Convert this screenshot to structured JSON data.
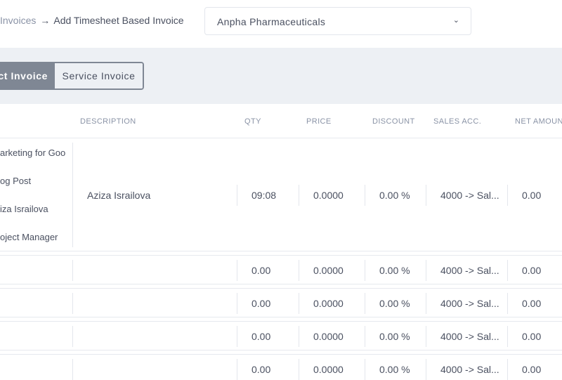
{
  "header": {
    "breadcrumb_link": "Invoices",
    "breadcrumb_arrow": "→",
    "breadcrumb_current": "Add Timesheet Based Invoice",
    "customer_value": "Anpha Pharmaceuticals"
  },
  "toggle": {
    "product_label": "ct Invoice",
    "service_label": "Service Invoice"
  },
  "table": {
    "columns": {
      "description": "DESCRIPTION",
      "qty": "QTY",
      "price": "PRICE",
      "discount": "DISCOUNT",
      "sales_acc": "SALES ACC.",
      "net_amount": "NET AMOUN"
    },
    "first_row": {
      "lines": [
        "arketing for Goo",
        "og Post",
        "iza Israilova",
        "oject Manager"
      ],
      "description": "Aziza Israilova",
      "qty": "09:08",
      "price": "0.0000",
      "discount": "0.00 %",
      "sales_acc": "4000 -> Sal...",
      "net_amount": "0.00"
    },
    "rows": [
      {
        "qty": "0.00",
        "price": "0.0000",
        "discount": "0.00 %",
        "sales_acc": "4000 -> Sal...",
        "net_amount": "0.00"
      },
      {
        "qty": "0.00",
        "price": "0.0000",
        "discount": "0.00 %",
        "sales_acc": "4000 -> Sal...",
        "net_amount": "0.00"
      },
      {
        "qty": "0.00",
        "price": "0.0000",
        "discount": "0.00 %",
        "sales_acc": "4000 -> Sal...",
        "net_amount": "0.00"
      },
      {
        "qty": "0.00",
        "price": "0.0000",
        "discount": "0.00 %",
        "sales_acc": "4000 -> Sal...",
        "net_amount": "0.00"
      }
    ]
  },
  "icons": {
    "dropdown": "chevron-down-icon"
  },
  "colors": {
    "toolbar_bg": "#edf0f4",
    "toggle_active": "#7f8794",
    "header_text": "#8a93a6"
  }
}
